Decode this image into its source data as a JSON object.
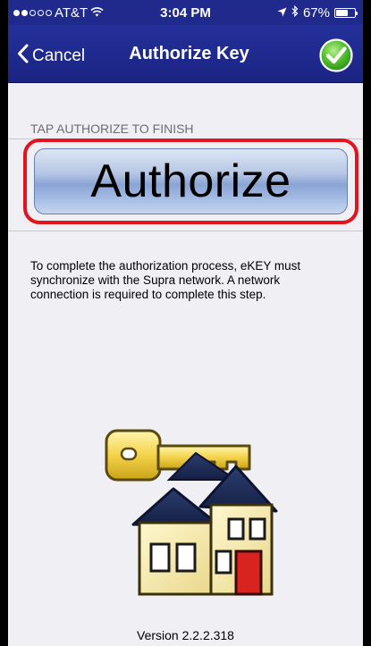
{
  "status_bar": {
    "carrier": "AT&T",
    "time": "3:04 PM",
    "battery_percent": "67%",
    "battery_level": 0.67,
    "signal_bars": 2
  },
  "nav": {
    "cancel_label": "Cancel",
    "title": "Authorize Key",
    "colors": {
      "bar": "#202a8c",
      "confirm": "#3fae2a"
    }
  },
  "section": {
    "header": "TAP AUTHORIZE TO FINISH",
    "authorize_label": "Authorize"
  },
  "description": "To complete the authorization process, eKEY must synchronize with the Supra network. A network connection is required to complete this step.",
  "footer": {
    "version": "Version 2.2.2.318"
  },
  "icons": [
    "back-chevron-icon",
    "checkmark-icon",
    "wifi-icon",
    "location-arrow-icon",
    "bluetooth-icon",
    "battery-icon",
    "key-house-icon"
  ]
}
